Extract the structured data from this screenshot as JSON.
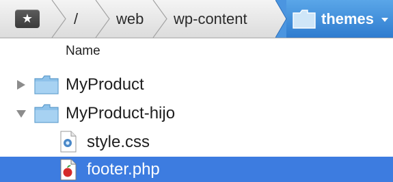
{
  "pathbar": {
    "favorites_icon": "star-icon",
    "segments": [
      "/",
      "web",
      "wp-content",
      "themes"
    ],
    "active_icon": "folder-icon",
    "menu_icon": "chevron-down-icon"
  },
  "columns": {
    "name_header": "Name"
  },
  "rows": [
    {
      "label": "MyProduct",
      "kind": "folder",
      "expanded": false
    },
    {
      "label": "MyProduct-hijo",
      "kind": "folder",
      "expanded": true
    },
    {
      "label": "style.css",
      "kind": "css-file"
    },
    {
      "label": "footer.php",
      "kind": "php-file",
      "selected": true
    }
  ],
  "colors": {
    "selection": "#3d7ce0",
    "active_crumb": "#3f8ede",
    "folder": "#8ec2ea"
  }
}
